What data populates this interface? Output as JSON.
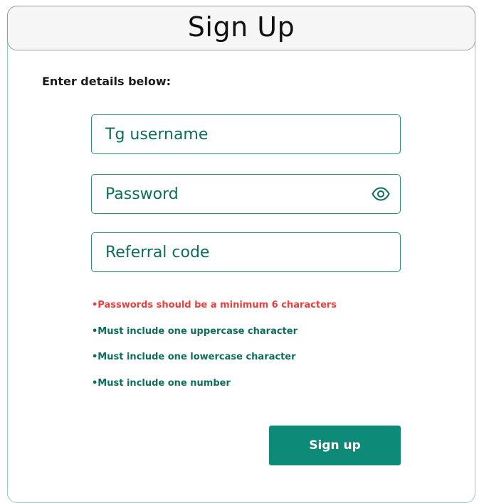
{
  "header": {
    "title": "Sign Up"
  },
  "form": {
    "subtitle": "Enter details below:",
    "username": {
      "placeholder": "Tg username",
      "value": ""
    },
    "password": {
      "placeholder": "Password",
      "value": ""
    },
    "referral": {
      "placeholder": "Referral code",
      "value": ""
    },
    "rules": [
      "•Passwords should be a minimum 6 characters",
      "•Must include one uppercase character",
      "•Must include one lowercase character",
      "•Must include one number"
    ],
    "submit_label": "Sign up"
  },
  "colors": {
    "accent": "#0e8a78",
    "text_accent": "#0d6e5e",
    "warning": "#e8403d",
    "border": "#2f8f7f"
  },
  "icons": {
    "password_toggle": "eye-icon"
  }
}
